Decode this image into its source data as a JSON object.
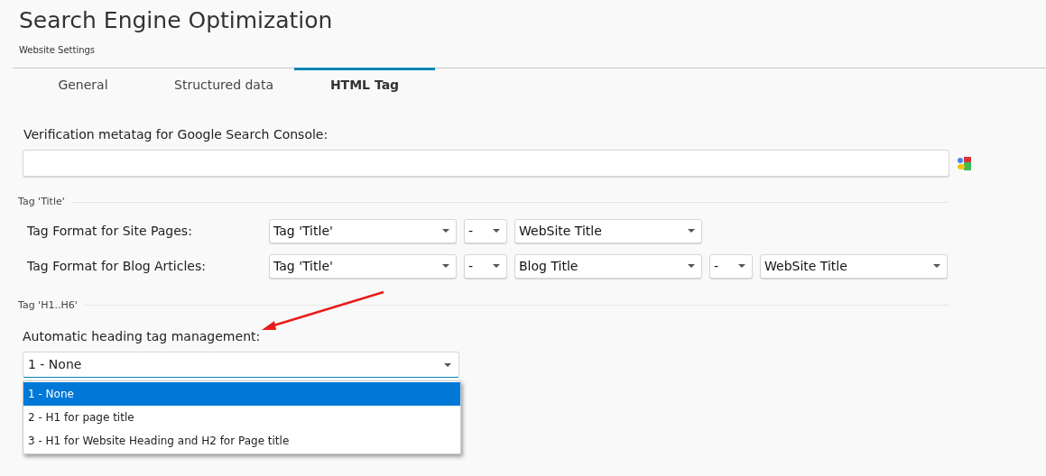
{
  "header": {
    "title": "Search Engine Optimization",
    "subtitle": "Website Settings"
  },
  "tabs": [
    {
      "label": "General",
      "selected": false
    },
    {
      "label": "Structured data",
      "selected": false
    },
    {
      "label": "HTML Tag",
      "selected": true
    }
  ],
  "verification": {
    "label": "Verification metatag for Google Search Console:"
  },
  "title_section": {
    "heading": "Tag 'Title'",
    "rows": [
      {
        "label": "Tag Format for Site Pages:",
        "selects": [
          {
            "kind": "format",
            "value": "Tag 'Title'"
          },
          {
            "kind": "separator",
            "value": "-"
          },
          {
            "kind": "format",
            "value": "WebSite Title"
          }
        ]
      },
      {
        "label": "Tag Format for Blog Articles:",
        "selects": [
          {
            "kind": "format",
            "value": "Tag 'Title'"
          },
          {
            "kind": "separator",
            "value": "-"
          },
          {
            "kind": "format",
            "value": "Blog Title"
          },
          {
            "kind": "separator",
            "value": "-"
          },
          {
            "kind": "format",
            "value": "WebSite Title"
          }
        ]
      }
    ]
  },
  "heading_section": {
    "heading": "Tag 'H1..H6'",
    "label": "Automatic heading tag management:",
    "value": "1 - None",
    "expanded": true,
    "options": [
      {
        "label": "1 - None",
        "selected": true
      },
      {
        "label": "2 - H1 for page title",
        "selected": false
      },
      {
        "label": "3 - H1 for Website Heading and H2 for Page title",
        "selected": false
      }
    ]
  }
}
